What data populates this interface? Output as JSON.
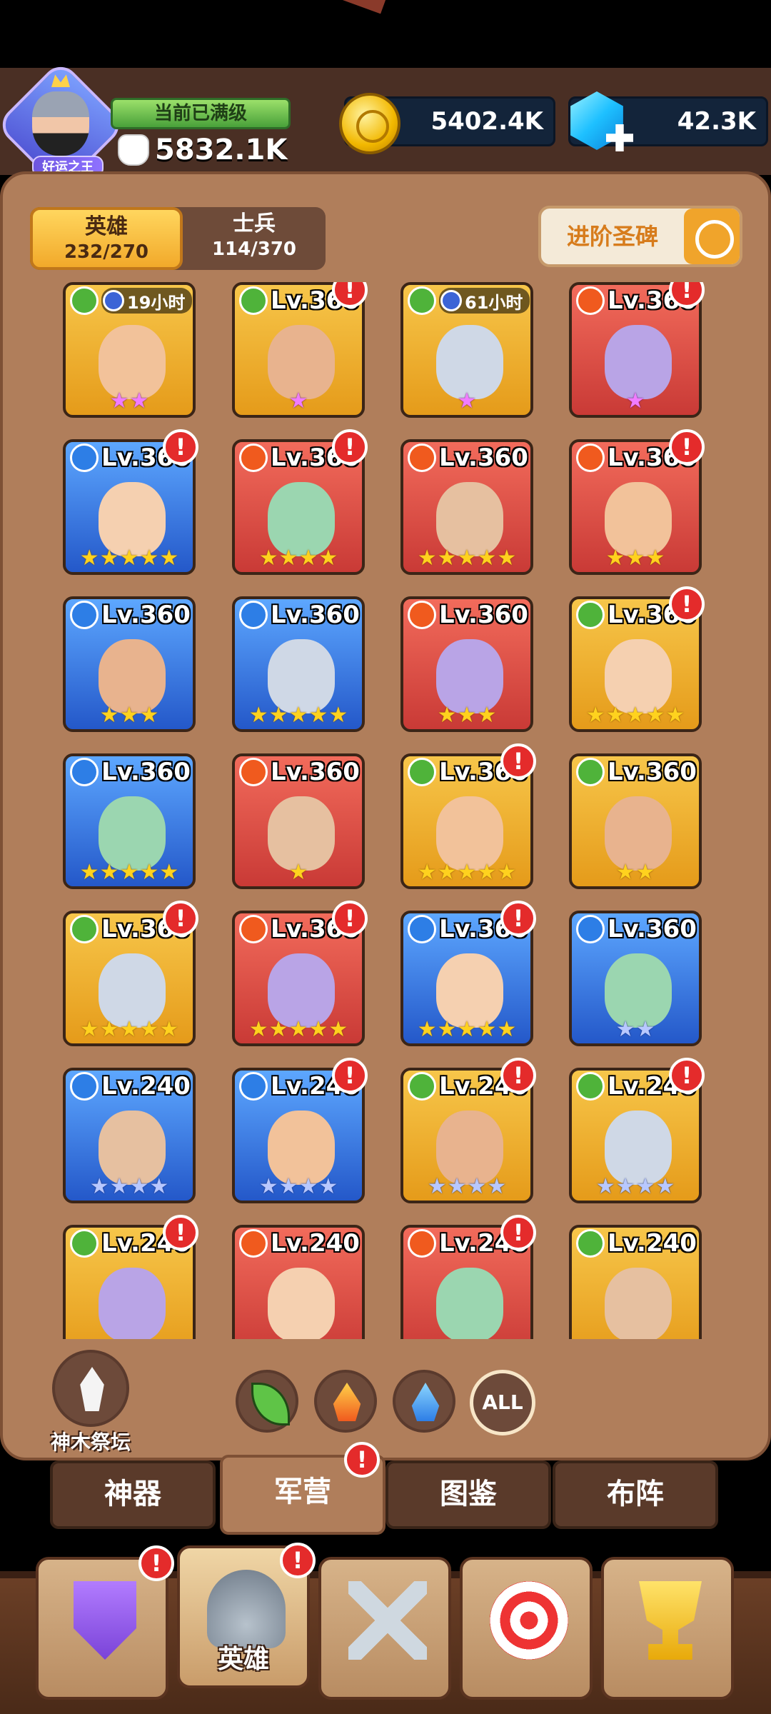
{
  "player": {
    "title": "好运之王",
    "level_status": "当前已满级",
    "power": "5832.1K"
  },
  "resources": {
    "gold": "5402.4K",
    "gems": "42.3K"
  },
  "tabs": {
    "hero": {
      "label": "英雄",
      "count": "232/270"
    },
    "soldier": {
      "label": "士兵",
      "count": "114/370"
    }
  },
  "advance_button": {
    "label": "进阶圣碑"
  },
  "heroes": [
    {
      "element": "leaf",
      "timer": "19小时",
      "stars": 2,
      "star_color": "pink",
      "alert": false
    },
    {
      "element": "leaf",
      "level": "Lv.360",
      "stars": 1,
      "star_color": "pink",
      "alert": true
    },
    {
      "element": "leaf",
      "timer": "61小时",
      "stars": 1,
      "star_color": "pink",
      "alert": false
    },
    {
      "element": "fire",
      "level": "Lv.360",
      "stars": 1,
      "star_color": "pink",
      "alert": true
    },
    {
      "element": "water",
      "level": "Lv.360",
      "stars": 5,
      "star_color": "gold",
      "alert": true
    },
    {
      "element": "fire",
      "level": "Lv.360",
      "stars": 4,
      "star_color": "gold",
      "alert": true
    },
    {
      "element": "fire",
      "level": "Lv.360",
      "stars": 5,
      "star_color": "gold",
      "alert": false
    },
    {
      "element": "fire",
      "level": "Lv.360",
      "stars": 3,
      "star_color": "gold",
      "alert": true
    },
    {
      "element": "water",
      "level": "Lv.360",
      "stars": 3,
      "star_color": "gold",
      "alert": false
    },
    {
      "element": "water",
      "level": "Lv.360",
      "stars": 5,
      "star_color": "gold",
      "alert": false
    },
    {
      "element": "fire",
      "level": "Lv.360",
      "stars": 3,
      "star_color": "gold",
      "alert": false
    },
    {
      "element": "leaf",
      "level": "Lv.360",
      "stars": 5,
      "star_color": "gold",
      "alert": true
    },
    {
      "element": "water",
      "level": "Lv.360",
      "stars": 5,
      "star_color": "gold",
      "alert": false
    },
    {
      "element": "fire",
      "level": "Lv.360",
      "stars": 1,
      "star_color": "gold",
      "alert": false
    },
    {
      "element": "leaf",
      "level": "Lv.360",
      "stars": 5,
      "star_color": "gold",
      "alert": true
    },
    {
      "element": "leaf",
      "level": "Lv.360",
      "stars": 2,
      "star_color": "gold",
      "alert": false
    },
    {
      "element": "leaf",
      "level": "Lv.360",
      "stars": 5,
      "star_color": "gold",
      "alert": true
    },
    {
      "element": "fire",
      "level": "Lv.360",
      "stars": 5,
      "star_color": "gold",
      "alert": true
    },
    {
      "element": "water",
      "level": "Lv.360",
      "stars": 5,
      "star_color": "gold",
      "alert": true
    },
    {
      "element": "water",
      "level": "Lv.360",
      "stars": 2,
      "star_color": "blue",
      "alert": false
    },
    {
      "element": "water",
      "level": "Lv.240",
      "stars": 4,
      "star_color": "blue",
      "alert": false
    },
    {
      "element": "water",
      "level": "Lv.240",
      "stars": 4,
      "star_color": "blue",
      "alert": true
    },
    {
      "element": "leaf",
      "level": "Lv.240",
      "stars": 4,
      "star_color": "blue",
      "alert": true
    },
    {
      "element": "leaf",
      "level": "Lv.240",
      "stars": 4,
      "star_color": "blue",
      "alert": true
    },
    {
      "element": "leaf",
      "level": "Lv.240",
      "stars": 0,
      "star_color": "blue",
      "alert": true
    },
    {
      "element": "fire",
      "level": "Lv.240",
      "stars": 0,
      "star_color": "blue",
      "alert": false
    },
    {
      "element": "fire",
      "level": "Lv.240",
      "stars": 0,
      "star_color": "blue",
      "alert": true
    },
    {
      "element": "leaf",
      "level": "Lv.240",
      "stars": 0,
      "star_color": "blue",
      "alert": false
    }
  ],
  "altar": {
    "label": "神木祭坛"
  },
  "filters": {
    "all_label": "ALL"
  },
  "subtabs": [
    "神器",
    "军营",
    "图鉴",
    "布阵"
  ],
  "nav": {
    "hero_label": "英雄"
  },
  "alert_glyph": "!",
  "colors": {
    "gold_star": "#ffd21e",
    "pink_star": "#f07cff",
    "blue_star": "#b8c8ff",
    "panel": "#b07e5b",
    "alert": "#e42b2b"
  }
}
